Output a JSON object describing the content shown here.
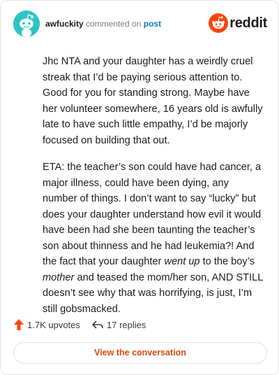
{
  "header": {
    "username": "awfuckity",
    "action_text": "commented on",
    "post_link": "post",
    "brand_name": "reddit",
    "brand_color": "#ff4500",
    "avatar_color": "#2ec4c6"
  },
  "comment": {
    "paragraph1": "Jhc NTA and your daughter has a weirdly cruel streak that I’d be paying serious attention to. Good for you for standing strong. Maybe have her volunteer somewhere, 16 years old is awfully late to have such little empathy, I’d be majorly focused on building that out.",
    "p2_part1": "ETA: the teacher’s son could have had cancer, a major illness, could have been dying, any number of things. I don’t want to say “lucky” but does your daughter understand how evil it would have been had she been taunting the teacher’s son about thinness and he had leukemia?! And the fact that your daughter ",
    "p2_em1": "went up",
    "p2_part2": " to the boy’s ",
    "p2_em2": "mother",
    "p2_part3": " and teased the mom/her son, AND STILL doesn’t see why that was horrifying, is just, I’m still gobsmacked."
  },
  "stats": {
    "upvotes_label": "1.7K upvotes",
    "replies_label": "17 replies",
    "upvote_icon": "upvote-arrow-icon",
    "reply_icon": "reply-arrow-icon",
    "upvote_color": "#ff4500"
  },
  "footer": {
    "view_button_label": "View the conversation",
    "button_text_color": "#d8490c"
  }
}
